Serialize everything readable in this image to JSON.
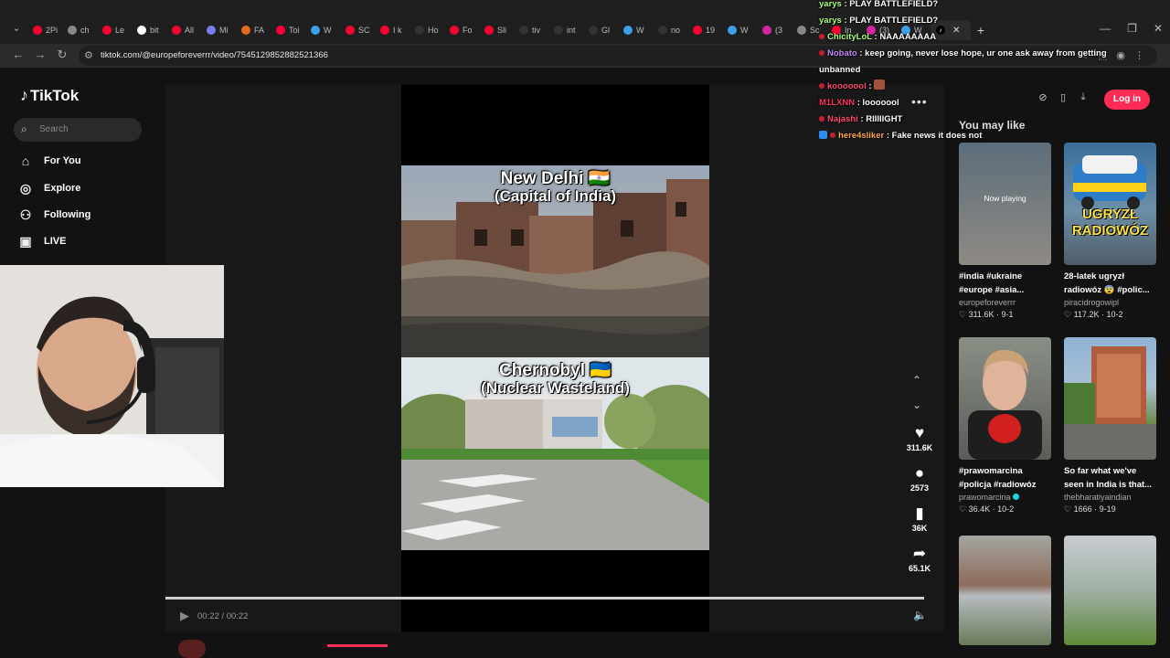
{
  "browser": {
    "tabs": [
      {
        "label": "2Pi",
        "icon": "youtube-icon",
        "color": "#ff0033"
      },
      {
        "label": "ch",
        "icon": "chrome-icon",
        "color": "#888888"
      },
      {
        "label": "Le",
        "icon": "youtube-icon",
        "color": "#ff0033"
      },
      {
        "label": "bit",
        "icon": "google-icon",
        "color": "#ffffff"
      },
      {
        "label": "All",
        "icon": "youtube-icon",
        "color": "#ff0033"
      },
      {
        "label": "Mi",
        "icon": "app-icon",
        "color": "#7b7bf0"
      },
      {
        "label": "FA",
        "icon": "app-icon",
        "color": "#e36a1c"
      },
      {
        "label": "Toi",
        "icon": "youtube-icon",
        "color": "#ff0033"
      },
      {
        "label": "W",
        "icon": "copilot-icon",
        "color": "#3aa0e8"
      },
      {
        "label": "SC",
        "icon": "youtube-icon",
        "color": "#ff0033"
      },
      {
        "label": "I k",
        "icon": "youtube-icon",
        "color": "#ff0033"
      },
      {
        "label": "Ho",
        "icon": "x-icon",
        "color": "#333333"
      },
      {
        "label": "Fo",
        "icon": "youtube-icon",
        "color": "#ff0033"
      },
      {
        "label": "Sli",
        "icon": "youtube-icon",
        "color": "#ff0033"
      },
      {
        "label": "tiv",
        "icon": "x-icon",
        "color": "#333333"
      },
      {
        "label": "int",
        "icon": "x-icon",
        "color": "#333333"
      },
      {
        "label": "Gl",
        "icon": "x-icon",
        "color": "#333333"
      },
      {
        "label": "W",
        "icon": "copilot-icon",
        "color": "#3aa0e8"
      },
      {
        "label": "no",
        "icon": "x-icon",
        "color": "#333333"
      },
      {
        "label": "19",
        "icon": "youtube-icon",
        "color": "#ff0033"
      },
      {
        "label": "W",
        "icon": "copilot-icon",
        "color": "#3aa0e8"
      },
      {
        "label": "(3",
        "icon": "instagram-icon",
        "color": "#d6249f"
      },
      {
        "label": "Sc",
        "icon": "pen-icon",
        "color": "#888888"
      },
      {
        "label": "In",
        "icon": "youtube-icon",
        "color": "#ff0033"
      },
      {
        "label": "(3)",
        "icon": "instagram-icon",
        "color": "#d6249f"
      },
      {
        "label": "W",
        "icon": "copilot-icon",
        "color": "#3aa0e8"
      }
    ],
    "url": "tiktok.com/@europeforeverrr/video/7545129852882521366"
  },
  "sidebar": {
    "logo": "TikTok",
    "search_placeholder": "Search",
    "nav": [
      {
        "label": "For You",
        "icon": "home-icon"
      },
      {
        "label": "Explore",
        "icon": "compass-icon"
      },
      {
        "label": "Following",
        "icon": "user-follow-icon"
      },
      {
        "label": "LIVE",
        "icon": "tv-icon"
      }
    ]
  },
  "video": {
    "caption_top": {
      "line1": "New Delhi 🇮🇳",
      "line2": "(Capital of India)"
    },
    "caption_bottom": {
      "line1": "Chernobyl 🇺🇦",
      "line2": "(Nuclear Wasteland)"
    },
    "time": "00:22 / 00:22",
    "progress": 1.0,
    "likes": "311.6K",
    "comments": "2573",
    "saves": "36K",
    "shares": "65.1K"
  },
  "header": {
    "login_label": "Log in"
  },
  "you_may_like": {
    "title": "You may like",
    "now_playing": "Now playing",
    "cards": [
      {
        "title": "#india #ukraine #europe #asia...",
        "author": "europeforeverrr",
        "verified": false,
        "likes": "311.6K",
        "date": "9-1"
      },
      {
        "title": "28-latek ugryzł radiowóz 😨 #polic...",
        "author": "piracidrogowipl",
        "verified": false,
        "likes": "117.2K",
        "date": "10-2"
      },
      {
        "title": "#prawomarcina #policja #radiowóz",
        "author": "prawomarcina",
        "verified": true,
        "likes": "36.4K",
        "date": "10-2"
      },
      {
        "title": "So far what we've seen in India is that...",
        "author": "thebharatiyaindian",
        "verified": false,
        "likes": "1666",
        "date": "9-19"
      }
    ],
    "thumb_text": {
      "ugryzl": "UGRYZŁ RADIOWÓZ"
    }
  },
  "chat": [
    {
      "user": "yarys",
      "color": "#aaff77",
      "text": "PLAY BATTLEFIELD?",
      "mark": "none"
    },
    {
      "user": "yarys",
      "color": "#aaff77",
      "text": "PLAY BATTLEFIELD?",
      "mark": "none"
    },
    {
      "user": "ChicityLoL",
      "color": "#aaff77",
      "text": "NAAAAAAAA",
      "mark": "dot"
    },
    {
      "user": "Nobato",
      "color": "#c68dff",
      "text": "keep going, never lose hope, ur one ask away from getting unbanned",
      "mark": "dot"
    },
    {
      "user": "kooooool",
      "color": "#ff4d6d",
      "text": "",
      "mark": "dot"
    },
    {
      "user": "M1LXNN",
      "color": "#ff3366",
      "text": "looooool",
      "mark": "none"
    },
    {
      "user": "Najashi",
      "color": "#ff4d6d",
      "text": "RIIIIIGHT",
      "mark": "dot"
    },
    {
      "user": "here4sliker",
      "color": "#ffa94d",
      "text": "Fake news it does not",
      "mark": "badge-dot"
    }
  ]
}
